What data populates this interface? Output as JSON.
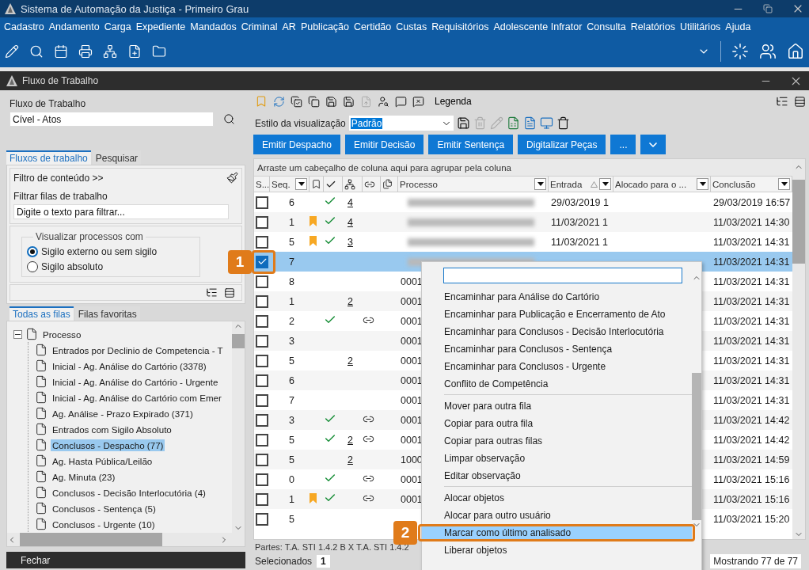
{
  "window": {
    "title": "Sistema de Automação da Justiça - Primeiro Grau"
  },
  "menu_bar": [
    "Cadastro",
    "Andamento",
    "Carga",
    "Expediente",
    "Mandados",
    "Criminal",
    "AR",
    "Publicação",
    "Certidão",
    "Custas",
    "Requisitórios",
    "Adolescente Infrator",
    "Consulta",
    "Relatórios",
    "Utilitários",
    "Ajuda"
  ],
  "sub_window": {
    "title": "Fluxo de Trabalho"
  },
  "left_panel": {
    "flow_label": "Fluxo de Trabalho",
    "flow_value": "Cível - Atos",
    "tabs": [
      {
        "label": "Fluxos de trabalho",
        "selected": true
      },
      {
        "label": "Pesquisar",
        "selected": false
      }
    ],
    "content_filter": "Filtro de conteúdo >>",
    "filter_label": "Filtrar filas de trabalho",
    "filter_value": "Digite o texto para filtrar...",
    "view_group": {
      "legend": "Visualizar processos com",
      "options": [
        {
          "label": "Sigilo externo ou sem sigilo",
          "selected": true
        },
        {
          "label": "Sigilo absoluto",
          "selected": false
        }
      ]
    },
    "queue_tabs": [
      {
        "label": "Todas as filas",
        "selected": true
      },
      {
        "label": "Filas favoritas",
        "selected": false
      }
    ],
    "tree": [
      {
        "label": "Processo",
        "expanded": true,
        "selected": false,
        "children": [
          {
            "label": "Entrados por Declinio de Competencia - T",
            "selected": false
          },
          {
            "label": "Inicial - Ag. Análise do Cartório (3378)",
            "selected": false
          },
          {
            "label": "Inicial - Ag. Análise do Cartório - Urgente",
            "selected": false
          },
          {
            "label": "Inicial - Ag. Análise do Cartório com Emer",
            "selected": false
          },
          {
            "label": "Ag. Análise - Prazo Expirado (371)",
            "selected": false
          },
          {
            "label": "Entrados com Sigilo Absoluto",
            "selected": false
          },
          {
            "label": "Conclusos - Despacho (77)",
            "selected": true
          },
          {
            "label": "Ag. Hasta Pública/Leilão",
            "selected": false
          },
          {
            "label": "Ag. Minuta (23)",
            "selected": false
          },
          {
            "label": "Conclusos - Decisão Interlocutória (4)",
            "selected": false
          },
          {
            "label": "Conclusos - Sentença (5)",
            "selected": false
          },
          {
            "label": "Conclusos - Urgente (10)",
            "selected": false
          }
        ]
      }
    ],
    "close_button": "Fechar"
  },
  "right_panel": {
    "legend_button": "Legenda",
    "view_style": {
      "label": "Estilo da visualização",
      "value": "Padrão"
    },
    "actions": [
      "Emitir Despacho",
      "Emitir Decisão",
      "Emitir Sentença",
      "Digitalizar Peças",
      "..."
    ],
    "group_hint": "Arraste um cabeçalho de coluna aqui para agrupar pela coluna",
    "columns": [
      {
        "kind": "text",
        "label": "S..."
      },
      {
        "kind": "text",
        "label": "Seq.",
        "filter": true,
        "sorted": false
      },
      {
        "kind": "bookmark"
      },
      {
        "kind": "check"
      },
      {
        "kind": "tree"
      },
      {
        "kind": "link"
      },
      {
        "kind": "document"
      },
      {
        "kind": "text",
        "label": "Processo",
        "filter": true,
        "sorted": false
      },
      {
        "kind": "text",
        "label": "Entrada",
        "filter": true,
        "sorted": true
      },
      {
        "kind": "text",
        "label": "Alocado para o ...",
        "filter": true,
        "sorted": false
      },
      {
        "kind": "text",
        "label": "Conclusão",
        "filter": true,
        "sorted": false
      }
    ],
    "rows": [
      {
        "checked": false,
        "selected": false,
        "seq": "6",
        "flagged": false,
        "done": true,
        "count": "4",
        "linked": false,
        "redacted": true,
        "entry": "29/03/2019 1",
        "conclusion": "29/03/2019 16:57"
      },
      {
        "checked": false,
        "selected": false,
        "seq": "1",
        "flagged": true,
        "done": true,
        "count": "4",
        "linked": false,
        "redacted": true,
        "entry": "11/03/2021 1",
        "conclusion": "11/03/2021 14:30"
      },
      {
        "checked": false,
        "selected": false,
        "seq": "5",
        "flagged": true,
        "done": true,
        "count": "3",
        "linked": false,
        "redacted": true,
        "entry": "11/03/2021 1",
        "conclusion": "11/03/2021 14:31"
      },
      {
        "checked": true,
        "selected": true,
        "seq": "7",
        "flagged": false,
        "done": false,
        "linked": false,
        "redacted": true,
        "conclusion": "11/03/2021 14:31"
      },
      {
        "checked": false,
        "selected": false,
        "seq": "8",
        "flagged": false,
        "done": false,
        "linked": false,
        "redacted": false,
        "process": "0001",
        "conclusion": "11/03/2021 14:31"
      },
      {
        "checked": false,
        "selected": false,
        "seq": "1",
        "flagged": false,
        "done": false,
        "count": "2",
        "linked": false,
        "redacted": false,
        "process": "0001",
        "conclusion": "11/03/2021 14:31"
      },
      {
        "checked": false,
        "selected": false,
        "seq": "2",
        "flagged": false,
        "done": true,
        "linked": true,
        "redacted": false,
        "process": "0001",
        "conclusion": "11/03/2021 14:31"
      },
      {
        "checked": false,
        "selected": false,
        "seq": "3",
        "flagged": false,
        "done": false,
        "linked": false,
        "redacted": false,
        "process": "0001",
        "conclusion": "11/03/2021 14:31"
      },
      {
        "checked": false,
        "selected": false,
        "seq": "5",
        "flagged": false,
        "done": false,
        "count": "2",
        "linked": false,
        "redacted": false,
        "process": "0001",
        "conclusion": "11/03/2021 14:31"
      },
      {
        "checked": false,
        "selected": false,
        "seq": "6",
        "flagged": false,
        "done": false,
        "linked": false,
        "redacted": false,
        "process": "0001",
        "conclusion": "11/03/2021 14:31"
      },
      {
        "checked": false,
        "selected": false,
        "seq": "7",
        "flagged": false,
        "done": false,
        "linked": false,
        "redacted": false,
        "process": "0001",
        "conclusion": "11/03/2021 14:31"
      },
      {
        "checked": false,
        "selected": false,
        "seq": "3",
        "flagged": false,
        "done": true,
        "linked": true,
        "redacted": false,
        "process": "0001",
        "conclusion": "11/03/2021 14:42"
      },
      {
        "checked": false,
        "selected": false,
        "seq": "5",
        "flagged": false,
        "done": true,
        "count": "2",
        "linked": true,
        "redacted": false,
        "process": "0001",
        "conclusion": "11/03/2021 14:42"
      },
      {
        "checked": false,
        "selected": false,
        "seq": "5",
        "flagged": false,
        "done": false,
        "count": "2",
        "linked": false,
        "redacted": false,
        "process": "1000",
        "conclusion": "11/03/2021 14:59"
      },
      {
        "checked": false,
        "selected": false,
        "seq": "0",
        "flagged": false,
        "done": true,
        "linked": true,
        "redacted": false,
        "process": "0001",
        "conclusion": "11/03/2021 15:16"
      },
      {
        "checked": false,
        "selected": false,
        "seq": "1",
        "flagged": true,
        "done": true,
        "linked": true,
        "redacted": false,
        "process": "0001",
        "conclusion": "11/03/2021 15:16"
      },
      {
        "checked": false,
        "selected": false,
        "seq": "5",
        "flagged": false,
        "done": false,
        "linked": false,
        "redacted": false,
        "conclusion": "11/03/2021 15:20"
      }
    ],
    "parts": "Partes: T.A. STI 1.4.2 B  X  T.A. STI 1.4.2",
    "selected_label": "Selecionados",
    "selected_count": "1",
    "showing": "Mostrando 77 de 77"
  },
  "context_menu": {
    "groups": [
      [
        {
          "label": "Encaminhar para Análise do Cartório",
          "selected": false
        },
        {
          "label": "Encaminhar para Publicação e Encerramento de Ato",
          "selected": false
        },
        {
          "label": "Encaminhar para Conclusos - Decisão Interlocutória",
          "selected": false
        },
        {
          "label": "Encaminhar para Conclusos - Sentença",
          "selected": false
        },
        {
          "label": "Encaminhar para Conclusos - Urgente",
          "selected": false
        },
        {
          "label": "Conflito de Competência",
          "selected": false
        }
      ],
      [
        {
          "label": "Mover para outra fila",
          "selected": false
        },
        {
          "label": "Copiar para outra fila",
          "selected": false
        },
        {
          "label": "Copiar para outras filas",
          "selected": false
        },
        {
          "label": "Limpar observação",
          "selected": false
        },
        {
          "label": "Editar observação",
          "selected": false
        }
      ],
      [
        {
          "label": "Alocar objetos",
          "selected": false
        },
        {
          "label": "Alocar para outro usuário",
          "selected": false
        },
        {
          "label": "Marcar como último analisado",
          "selected": true
        },
        {
          "label": "Liberar objetos",
          "selected": false
        }
      ]
    ]
  },
  "callouts": [
    {
      "label": "1"
    },
    {
      "label": "2"
    }
  ]
}
